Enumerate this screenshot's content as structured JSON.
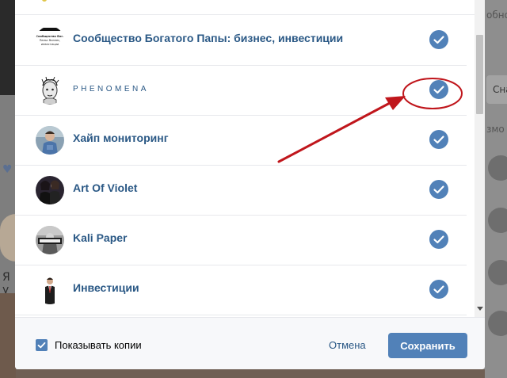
{
  "dialog": {
    "rows": [
      {
        "name": "Сообщество Богатого Папы: бизнес, инвестиции",
        "checked": true,
        "avatar": "text-logo",
        "avatar_text": "Сообщество Богатого Папы: бизнес, инвестиции"
      },
      {
        "name": "PHENOMENA",
        "checked": true,
        "avatar": "sketch-face",
        "style": "spaced"
      },
      {
        "name": "Хайп мониторинг",
        "checked": true,
        "avatar": "photo-person"
      },
      {
        "name": "Art Of Violet",
        "checked": true,
        "avatar": "photo-dark"
      },
      {
        "name": "Kali Paper",
        "checked": true,
        "avatar": "photo-bw-label"
      },
      {
        "name": "Инвестиции",
        "checked": true,
        "avatar": "suit-man"
      }
    ],
    "footer": {
      "show_copies_label": "Показывать копии",
      "show_copies_checked": true,
      "cancel_label": "Отмена",
      "save_label": "Сохранить"
    }
  },
  "background": {
    "left_fragment_text": "Я у",
    "right_fragment_1": "обно",
    "right_fragment_2": "Сна",
    "right_fragment_3": "змо"
  },
  "annotation": {
    "color": "#c0161c",
    "target": "PHENOMENA check icon"
  },
  "colors": {
    "accent": "#5181b8",
    "link": "#2a5885",
    "divider": "#e7e8ec"
  }
}
